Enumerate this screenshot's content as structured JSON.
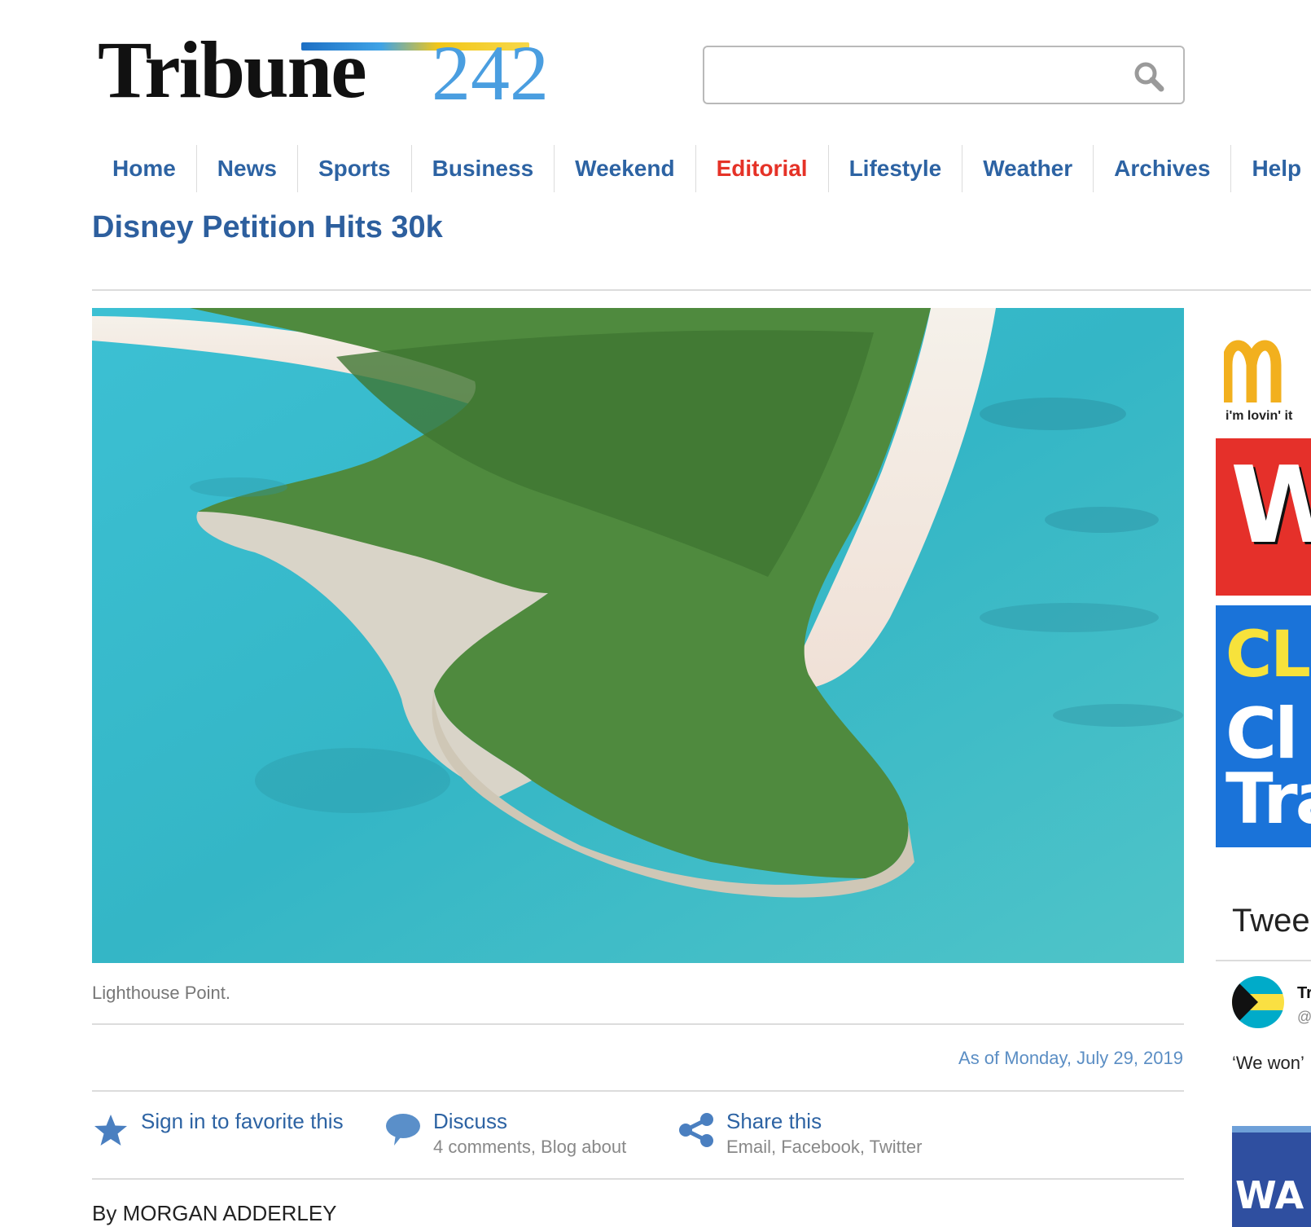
{
  "brand": {
    "name_part1": "Tribune",
    "name_part2": "242"
  },
  "search": {
    "value": "",
    "placeholder": ""
  },
  "nav": [
    {
      "label": "Home"
    },
    {
      "label": "News"
    },
    {
      "label": "Sports"
    },
    {
      "label": "Business"
    },
    {
      "label": "Weekend"
    },
    {
      "label": "Editorial"
    },
    {
      "label": "Lifestyle"
    },
    {
      "label": "Weather"
    },
    {
      "label": "Archives"
    },
    {
      "label": "Help"
    }
  ],
  "article": {
    "title": "Disney Petition Hits 30k",
    "image_caption": "Lighthouse Point.",
    "date": "As of Monday, July 29, 2019",
    "byline": "By MORGAN ADDERLEY"
  },
  "actions": {
    "favorite": {
      "title": "Sign in to favorite this"
    },
    "discuss": {
      "title": "Discuss",
      "sub": "4 comments, Blog about"
    },
    "share": {
      "title": "Share this",
      "sub": "Email, Facebook, Twitter"
    }
  },
  "sidebar": {
    "ad_mcd_slogan": "i'm lovin' it",
    "ad_red_text": "W",
    "ad_blue_line1": "CLI",
    "ad_blue_line2": "Cl",
    "ad_blue_line3": "Tra",
    "tweets_heading": "Twee",
    "tweet_name": "Tr",
    "tweet_handle": "@",
    "tweet_text": "‘We won’",
    "tweet_image_text": "WA"
  },
  "colors": {
    "nav_link": "#2d63a3",
    "nav_active": "#e53227",
    "title": "#2d5f9e",
    "date": "#5b8ec4"
  }
}
